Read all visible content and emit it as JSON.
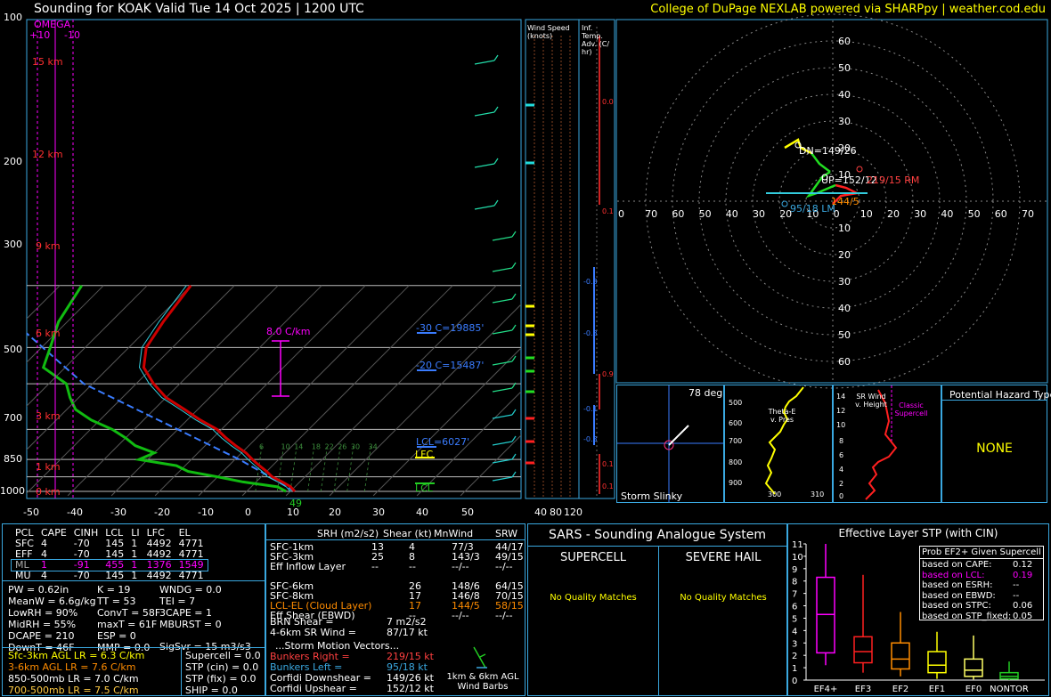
{
  "header": {
    "title": "Sounding for KOAK Valid  Tue 14 Oct 2025 | 1200 UTC",
    "credit": "College of DuPage NEXLAB powered via SHARPpy | weather.cod.edu"
  },
  "skewt": {
    "omega_label": "OMEGA",
    "omega_ticks": [
      "+10",
      "-10"
    ],
    "pressure_ticks": [
      "100",
      "200",
      "300",
      "500",
      "700",
      "850",
      "1000"
    ],
    "height_labels": [
      "15 km",
      "12 km",
      "9 km",
      "6 km",
      "3 km",
      "1 km",
      "0 km"
    ],
    "temp_ticks": [
      "-50",
      "-40",
      "-30",
      "-20",
      "-10",
      "0",
      "10",
      "20",
      "30",
      "40",
      "50"
    ],
    "lapse_label": "8.0 C/km",
    "level_labels": [
      "-30 C=19885'",
      "-20 C=15487'",
      "LCL=6027'"
    ],
    "marker_labels": [
      "LFC",
      "LCL"
    ],
    "sfc_temp": "49",
    "mixing_ratios": [
      "6",
      "10",
      "14",
      "18",
      "22",
      "26",
      "30",
      "34"
    ],
    "wind_speed_label": "Wind Speed (knots)",
    "wind_speed_ticks": [
      "40",
      "80",
      "120"
    ],
    "inf_temp_label": "Inf. Temp. Adv. (C/ hr)",
    "inf_temp_values": [
      "0.0",
      "0.1",
      "-0.8",
      "-0.8",
      "0.9",
      "-0.1",
      "-0.3",
      "0.1",
      "0.1"
    ]
  },
  "hodograph": {
    "range_labels": [
      "60",
      "50",
      "40",
      "30",
      "20",
      "10"
    ],
    "x_labels": [
      "0",
      "70",
      "60",
      "50",
      "40",
      "30",
      "20",
      "10",
      "0",
      "10",
      "20",
      "30",
      "40",
      "50",
      "60",
      "70"
    ],
    "annotations": {
      "dn": "DN=149/26",
      "up": "UP=152/12",
      "rm": "219/15 RM",
      "lm": "95/18 LM",
      "cl": "144/5"
    }
  },
  "slinky": {
    "deg": "78 deg",
    "label": "Storm Slinky"
  },
  "theta_panel": {
    "label": "Theta-E v. Pres",
    "yticks": [
      "500",
      "600",
      "700",
      "800",
      "900"
    ],
    "xticks": [
      "300",
      "310"
    ]
  },
  "srwind_panel": {
    "label": "SR Wind v. Height",
    "marker": "Classic Supercell",
    "yticks": [
      "14",
      "12",
      "10",
      "8",
      "6",
      "4",
      "2",
      "0"
    ]
  },
  "hazard": {
    "title": "Potential Hazard Type",
    "value": "NONE"
  },
  "parcel_table": {
    "headers": [
      "PCL",
      "CAPE",
      "CINH",
      "LCL",
      "LI",
      "LFC",
      "EL"
    ],
    "rows": [
      [
        "SFC",
        "4",
        "-70",
        "145",
        "1",
        "4492",
        "4771"
      ],
      [
        "EFF",
        "4",
        "-70",
        "145",
        "1",
        "4492",
        "4771"
      ],
      [
        "ML",
        "1",
        "-91",
        "455",
        "1",
        "1376",
        "1549"
      ],
      [
        "MU",
        "4",
        "-70",
        "145",
        "1",
        "4492",
        "4771"
      ]
    ]
  },
  "indices": {
    "col1": [
      "PW = 0.62in",
      "MeanW = 6.6g/kg",
      "LowRH = 90%",
      "MidRH = 55%",
      "DCAPE = 210",
      "DownT = 46F"
    ],
    "col2": [
      "K = 19",
      "TT = 53",
      "ConvT = 58F",
      "maxT = 61F",
      "ESP = 0",
      "MMP = 0.0"
    ],
    "col3": [
      "WNDG = 0.0",
      "TEI = 7",
      "3CAPE = 1",
      "MBURST = 0",
      "",
      "SigSvr = 15 m3/s3"
    ]
  },
  "lapse_rates": [
    "Sfc-3km AGL LR = 6.3 C/km",
    "3-6km AGL LR = 7.6 C/km",
    "850-500mb LR = 7.0 C/km",
    "700-500mb LR = 7.5 C/km"
  ],
  "composites": [
    "Supercell = 0.0",
    "STP (cin) = 0.0",
    "STP (fix) = 0.0",
    "SHIP = 0.0"
  ],
  "kinematics": {
    "headers": [
      "SRH (m2/s2)",
      "Shear (kt)",
      "MnWind",
      "SRW"
    ],
    "rows": [
      [
        "SFC-1km",
        "13",
        "4",
        "77/3",
        "44/17"
      ],
      [
        "SFC-3km",
        "25",
        "8",
        "143/3",
        "49/15"
      ],
      [
        "Eff Inflow Layer",
        "--",
        "--",
        "--/--",
        "--/--"
      ],
      [
        "",
        "",
        "",
        "",
        ""
      ],
      [
        "SFC-6km",
        "",
        "26",
        "148/6",
        "64/15"
      ],
      [
        "SFC-8km",
        "",
        "17",
        "146/8",
        "70/15"
      ],
      [
        "LCL-EL (Cloud Layer)",
        "",
        "17",
        "144/5",
        "58/15"
      ],
      [
        "Eff Shear (EBWD)",
        "",
        "--",
        "--/--",
        "--/--"
      ]
    ],
    "brn": [
      "BRN Shear =",
      "7 m2/s2"
    ],
    "srwind46": [
      "4-6km SR Wind =",
      "87/17 kt"
    ],
    "storm_motion_title": "...Storm Motion Vectors...",
    "motions": [
      [
        "Bunkers Right =",
        "219/15 kt"
      ],
      [
        "Bunkers Left =",
        "95/18 kt"
      ],
      [
        "Corfidi Downshear =",
        "149/26 kt"
      ],
      [
        "Corfidi Upshear =",
        "152/12 kt"
      ]
    ],
    "barb_label": "1km & 6km AGL Wind Barbs"
  },
  "sars": {
    "title": "SARS - Sounding Analogue System",
    "supercell": "SUPERCELL",
    "hail": "SEVERE HAIL",
    "sup_result": "No Quality Matches",
    "hail_result": "No Quality Matches"
  },
  "stp": {
    "title": "Effective Layer STP (with CIN)",
    "legend_title": "Prob EF2+ Given Supercell",
    "legend": [
      [
        "based on CAPE:",
        "0.12"
      ],
      [
        "based on LCL:",
        "0.19"
      ],
      [
        "based on ESRH:",
        "--"
      ],
      [
        "based on EBWD:",
        "--"
      ],
      [
        "based on STPC:",
        "0.06"
      ],
      [
        "based on STP_fixed:",
        "0.05"
      ]
    ]
  },
  "chart_data": [
    {
      "type": "line",
      "title": "Sounding for KOAK Valid  Tue 14 Oct 2025 | 1200 UTC",
      "xlabel": "",
      "ylabel": "",
      "y_scale": "log (pressure, mb)",
      "ylim": [
        1000,
        100
      ],
      "xlim": [
        -50,
        50
      ],
      "series": [
        {
          "pressure_mb": [
            1000,
            950,
            900,
            850,
            800,
            750,
            700,
            650,
            600,
            550,
            500,
            450,
            400,
            350,
            300,
            250,
            200,
            150,
            100
          ],
          "values": [
            11,
            9,
            6,
            2.5,
            0,
            -3,
            -6,
            -9,
            -13,
            -17,
            -21,
            -27,
            -33,
            -40,
            -46,
            -52,
            -56,
            -58,
            -60
          ]
        },
        {
          "pressure_mb": [
            1000,
            950,
            900,
            850,
            800,
            750,
            700,
            650,
            600,
            550,
            500,
            450,
            400,
            350,
            300,
            250,
            200,
            150,
            100
          ],
          "values": [
            9,
            6,
            -3,
            -10,
            -18,
            -22,
            -32,
            -30,
            -36,
            -40,
            -45,
            -52,
            -58,
            -62,
            -66,
            -75,
            -78,
            -82,
            -85
          ]
        }
      ]
    },
    {
      "type": "bar",
      "title": "Effective Layer STP (with CIN)",
      "categories": [
        "EF4+",
        "EF3",
        "EF2",
        "EF1",
        "EF0",
        "NONTOR"
      ],
      "ylim": [
        0,
        11
      ],
      "yticks": [
        "0",
        "1",
        "2",
        "3",
        "4",
        "5",
        "6",
        "7",
        "8",
        "9",
        "10",
        "11"
      ],
      "box_whisker": [
        {
          "name": "EF4+",
          "min": 1.2,
          "q1": 2.2,
          "median": 5.3,
          "q3": 8.3,
          "max": 11.0
        },
        {
          "name": "EF3",
          "min": 0.6,
          "q1": 1.4,
          "median": 2.3,
          "q3": 3.5,
          "max": 8.5
        },
        {
          "name": "EF2",
          "min": 0.3,
          "q1": 0.9,
          "median": 1.7,
          "q3": 3.0,
          "max": 5.5
        },
        {
          "name": "EF1",
          "min": 0.1,
          "q1": 0.6,
          "median": 1.2,
          "q3": 2.3,
          "max": 3.9
        },
        {
          "name": "EF0",
          "min": 0.05,
          "q1": 0.3,
          "median": 0.8,
          "q3": 1.7,
          "max": 3.6
        },
        {
          "name": "NONTOR",
          "min": 0.0,
          "q1": 0.1,
          "median": 0.3,
          "q3": 0.6,
          "max": 1.5
        }
      ],
      "colors": [
        "#ff00ff",
        "#ff2020",
        "#ff8c00",
        "#ffff00",
        "#ffff66",
        "#22cc22"
      ]
    }
  ]
}
